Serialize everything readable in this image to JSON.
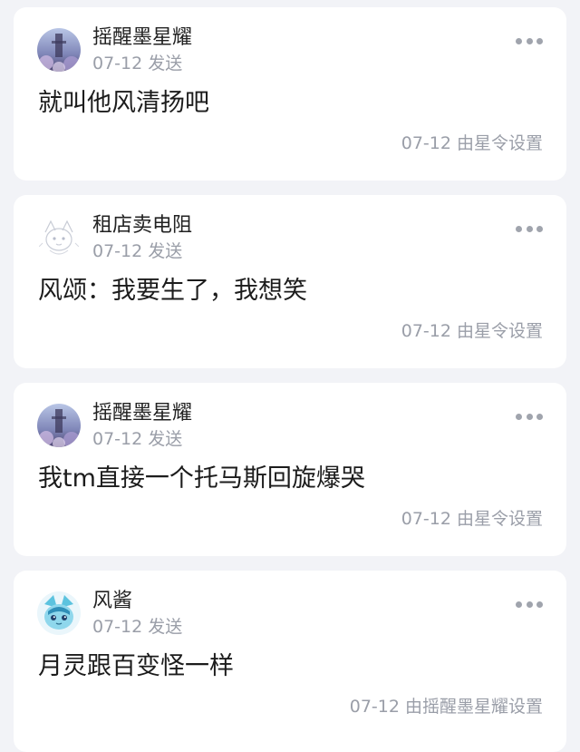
{
  "messages": [
    {
      "author": "摇醒墨星耀",
      "avatar_icon": "blue-sky-avatar-icon",
      "sent": "07-12 发送",
      "text": "就叫他风清扬吧",
      "footer": "07-12 由星令设置"
    },
    {
      "author": "租店卖电阻",
      "avatar_icon": "sketch-fox-avatar-icon",
      "sent": "07-12 发送",
      "text": "风颂：我要生了，我想笑",
      "footer": "07-12 由星令设置"
    },
    {
      "author": "摇醒墨星耀",
      "avatar_icon": "blue-sky-avatar-icon",
      "sent": "07-12 发送",
      "text": "我tm直接一个托马斯回旋爆哭",
      "footer": "07-12 由星令设置"
    },
    {
      "author": "风酱",
      "avatar_icon": "glaceon-avatar-icon",
      "sent": "07-12 发送",
      "text": "月灵跟百变怪一样",
      "footer": "07-12 由摇醒墨星耀设置"
    }
  ],
  "colors": {
    "page_background": "#f2f3f7",
    "card_background": "#ffffff",
    "primary_text": "#1c1c1c",
    "secondary_text": "#9a9ea8"
  }
}
